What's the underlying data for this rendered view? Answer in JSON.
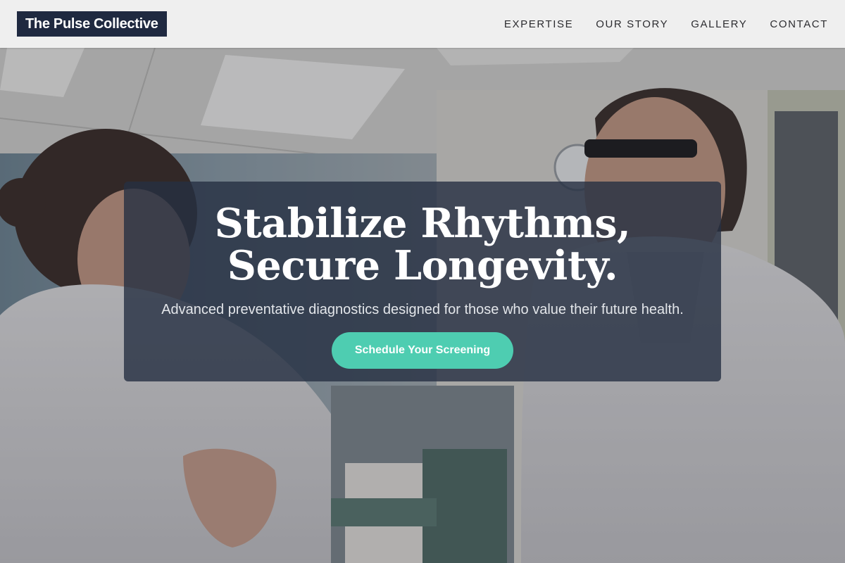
{
  "header": {
    "brand": "The Pulse Collective",
    "nav": [
      {
        "label": "EXPERTISE"
      },
      {
        "label": "OUR STORY"
      },
      {
        "label": "GALLERY"
      },
      {
        "label": "CONTACT"
      }
    ]
  },
  "hero": {
    "title": "Stabilize Rhythms, Secure Longevity.",
    "subtitle": "Advanced preventative diagnostics designed for those who value their future health.",
    "cta_label": "Schedule Your Screening"
  },
  "colors": {
    "brand_background": "#1f2940",
    "header_background": "#efefef",
    "card_background": "#263042",
    "cta_accent": "#4ecdb1"
  }
}
